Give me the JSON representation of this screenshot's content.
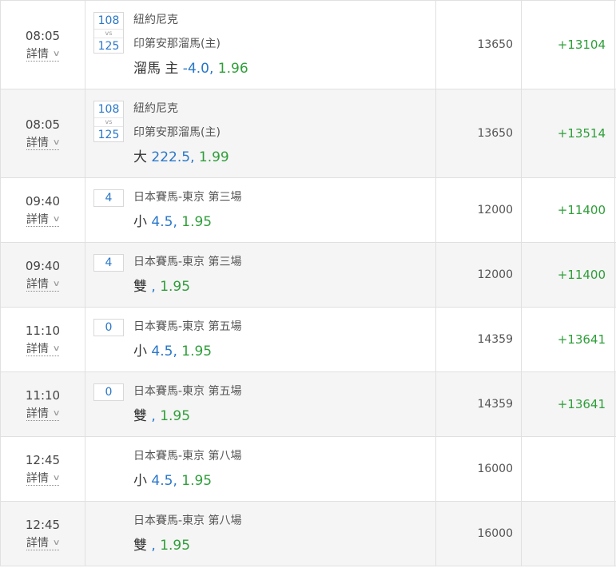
{
  "bets": [
    {
      "time": "08:05",
      "details": "詳情",
      "score": {
        "home": "108",
        "vs": "vs",
        "away": "125"
      },
      "teams": [
        "紐約尼克",
        "印第安那溜馬(主)"
      ],
      "selection": "溜馬 主",
      "line": " -4.0",
      "sep": ",",
      "odds": " 1.96",
      "stake": "13650",
      "return": "+13104"
    },
    {
      "time": "08:05",
      "details": "詳情",
      "score": {
        "home": "108",
        "vs": "vs",
        "away": "125"
      },
      "teams": [
        "紐約尼克",
        "印第安那溜馬(主)"
      ],
      "selection": "大",
      "line": " 222.5",
      "sep": ",",
      "odds": " 1.99",
      "stake": "13650",
      "return": "+13514"
    },
    {
      "time": "09:40",
      "details": "詳情",
      "result": "4",
      "event": "日本賽馬-東京 第三場",
      "selection": "小",
      "line": " 4.5",
      "sep": ",",
      "odds": " 1.95",
      "stake": "12000",
      "return": "+11400"
    },
    {
      "time": "09:40",
      "details": "詳情",
      "result": "4",
      "event": "日本賽馬-東京 第三場",
      "selection": "雙",
      "line": " ",
      "sep": ",",
      "odds": " 1.95",
      "stake": "12000",
      "return": "+11400"
    },
    {
      "time": "11:10",
      "details": "詳情",
      "result": "0",
      "event": "日本賽馬-東京 第五場",
      "selection": "小",
      "line": " 4.5",
      "sep": ",",
      "odds": " 1.95",
      "stake": "14359",
      "return": "+13641"
    },
    {
      "time": "11:10",
      "details": "詳情",
      "result": "0",
      "event": "日本賽馬-東京 第五場",
      "selection": "雙",
      "line": " ",
      "sep": ",",
      "odds": " 1.95",
      "stake": "14359",
      "return": "+13641"
    },
    {
      "time": "12:45",
      "details": "詳情",
      "event": "日本賽馬-東京 第八場",
      "selection": "小",
      "line": " 4.5",
      "sep": ",",
      "odds": " 1.95",
      "stake": "16000",
      "return": ""
    },
    {
      "time": "12:45",
      "details": "詳情",
      "event": "日本賽馬-東京 第八場",
      "selection": "雙",
      "line": " ",
      "sep": ",",
      "odds": " 1.95",
      "stake": "16000",
      "return": ""
    }
  ],
  "icons": {
    "details_toggle": "chevron-down-icon"
  },
  "colors": {
    "line": "#2a77c9",
    "odds": "#2f9e3a",
    "return": "#2f9e3a"
  }
}
